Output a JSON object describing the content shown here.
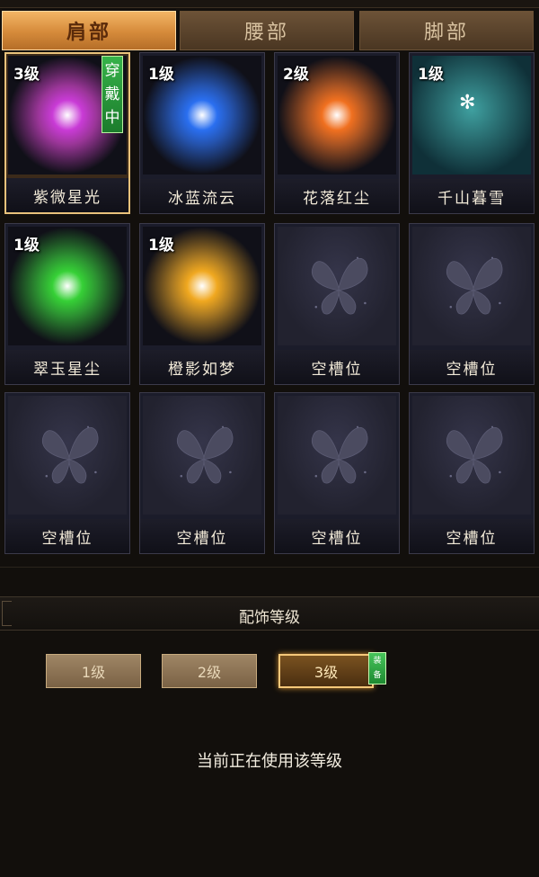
{
  "tabs": [
    {
      "label": "肩部",
      "active": true
    },
    {
      "label": "腰部",
      "active": false
    },
    {
      "label": "脚部",
      "active": false
    }
  ],
  "items": [
    {
      "name": "紫微星光",
      "level": "3级",
      "wearing": "穿戴中",
      "color": "#c93bd6",
      "empty": false,
      "selected": true
    },
    {
      "name": "冰蓝流云",
      "level": "1级",
      "wearing": "",
      "color": "#2a6ff0",
      "empty": false,
      "selected": false
    },
    {
      "name": "花落红尘",
      "level": "2级",
      "wearing": "",
      "color": "#f07020",
      "empty": false,
      "selected": false
    },
    {
      "name": "千山暮雪",
      "level": "1级",
      "wearing": "",
      "color": "#2f8c8c",
      "empty": false,
      "selected": false
    },
    {
      "name": "翠玉星尘",
      "level": "1级",
      "wearing": "",
      "color": "#36d036",
      "empty": false,
      "selected": false
    },
    {
      "name": "橙影如梦",
      "level": "1级",
      "wearing": "",
      "color": "#f0a820",
      "empty": false,
      "selected": false
    },
    {
      "name": "空槽位",
      "level": "",
      "wearing": "",
      "color": "",
      "empty": true,
      "selected": false
    },
    {
      "name": "空槽位",
      "level": "",
      "wearing": "",
      "color": "",
      "empty": true,
      "selected": false
    },
    {
      "name": "空槽位",
      "level": "",
      "wearing": "",
      "color": "",
      "empty": true,
      "selected": false
    },
    {
      "name": "空槽位",
      "level": "",
      "wearing": "",
      "color": "",
      "empty": true,
      "selected": false
    },
    {
      "name": "空槽位",
      "level": "",
      "wearing": "",
      "color": "",
      "empty": true,
      "selected": false
    },
    {
      "name": "空槽位",
      "level": "",
      "wearing": "",
      "color": "",
      "empty": true,
      "selected": false
    }
  ],
  "section": {
    "title": "配饰等级"
  },
  "level_buttons": [
    {
      "label": "1级",
      "active": false
    },
    {
      "label": "2级",
      "active": false
    },
    {
      "label": "3级",
      "active": true,
      "tag": "装备"
    }
  ],
  "status": "当前正在使用该等级"
}
